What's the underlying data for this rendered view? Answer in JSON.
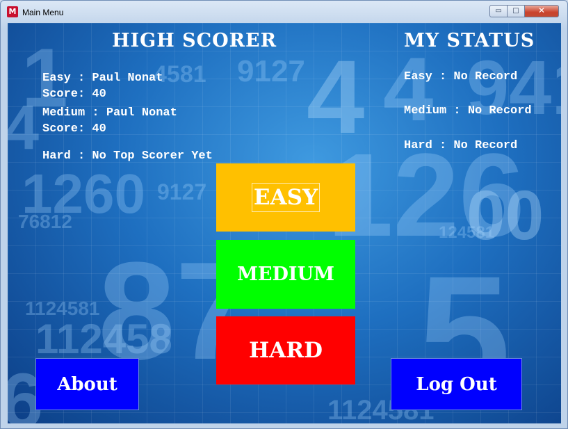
{
  "window": {
    "title": "Main Menu",
    "controls": {
      "minimize": "▭",
      "maximize": "□",
      "close": "✕"
    },
    "icon_letter": "M"
  },
  "high_scorer": {
    "heading": "HIGH SCORER",
    "easy_name": "Easy : Paul Nonat",
    "easy_score": "Score: 40",
    "medium_name": "Medium : Paul Nonat",
    "medium_score": "Score: 40",
    "hard": "Hard : No Top Scorer Yet"
  },
  "my_status": {
    "heading": "MY STATUS",
    "easy": "Easy : No Record",
    "medium": "Medium : No Record",
    "hard": "Hard : No Record"
  },
  "buttons": {
    "easy": "EASY",
    "medium": "MEDIUM",
    "hard": "HARD",
    "about": "About",
    "logout": "Log Out"
  },
  "colors": {
    "easy": "#ffc000",
    "medium": "#00ff00",
    "hard": "#ff0000",
    "about": "#0000ff",
    "logout": "#0000ff"
  }
}
